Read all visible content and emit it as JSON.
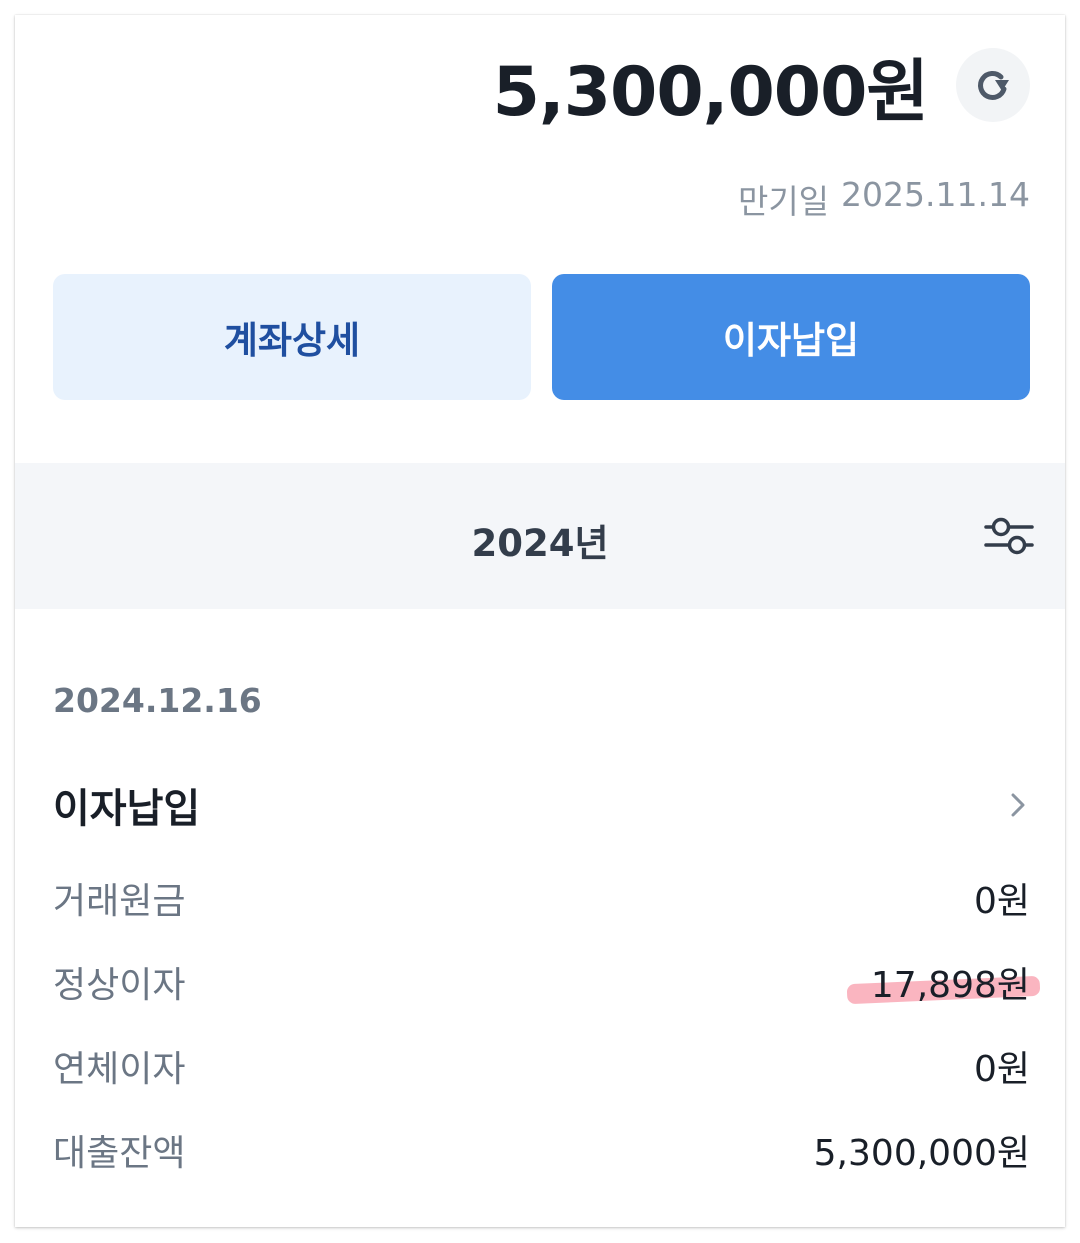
{
  "summary": {
    "amount": "5,300,000원",
    "maturity_label": "만기일",
    "maturity_date": "2025.11.14"
  },
  "buttons": {
    "detail": "계좌상세",
    "pay_interest": "이자납입"
  },
  "filter": {
    "year": "2024년"
  },
  "transaction": {
    "date": "2024.12.16",
    "title": "이자납입",
    "rows": [
      {
        "label": "거래원금",
        "value": "0원"
      },
      {
        "label": "정상이자",
        "value": "17,898원"
      },
      {
        "label": "연체이자",
        "value": "0원"
      },
      {
        "label": "대출잔액",
        "value": "5,300,000원"
      }
    ]
  },
  "colors": {
    "primary": "#448de6",
    "primary_light": "#e8f2fd",
    "primary_dark_text": "#1f4fa0",
    "highlight": "#f5788c"
  },
  "icons": {
    "refresh": "refresh-icon",
    "filter": "filter-sliders-icon",
    "chevron": "chevron-right-icon"
  }
}
